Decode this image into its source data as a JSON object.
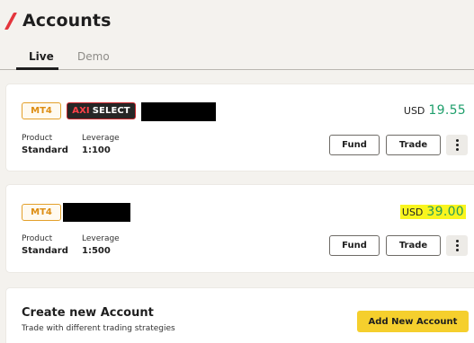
{
  "page": {
    "title": "Accounts"
  },
  "tabs": [
    {
      "label": "Live",
      "active": true
    },
    {
      "label": "Demo",
      "active": false
    }
  ],
  "accounts": [
    {
      "platform": "MT4",
      "tier_prefix": "AXI",
      "tier_name": "SELECT",
      "currency": "USD",
      "balance": "19.55",
      "product_label": "Product",
      "product_value": "Standard",
      "leverage_label": "Leverage",
      "leverage_value": "1:100",
      "fund_label": "Fund",
      "trade_label": "Trade"
    },
    {
      "platform": "MT4",
      "currency": "USD",
      "balance": "39.00",
      "product_label": "Product",
      "product_value": "Standard",
      "leverage_label": "Leverage",
      "leverage_value": "1:500",
      "fund_label": "Fund",
      "trade_label": "Trade"
    }
  ],
  "create": {
    "title": "Create new Account",
    "subtitle": "Trade with different trading strategies",
    "button_label": "Add New Account"
  },
  "colors": {
    "accent": "#e4353c",
    "balance_green": "#1f9f6c",
    "highlight": "#f9f51e",
    "primary_button": "#f5cf2d",
    "mt4_tag": "#e3a02a"
  }
}
